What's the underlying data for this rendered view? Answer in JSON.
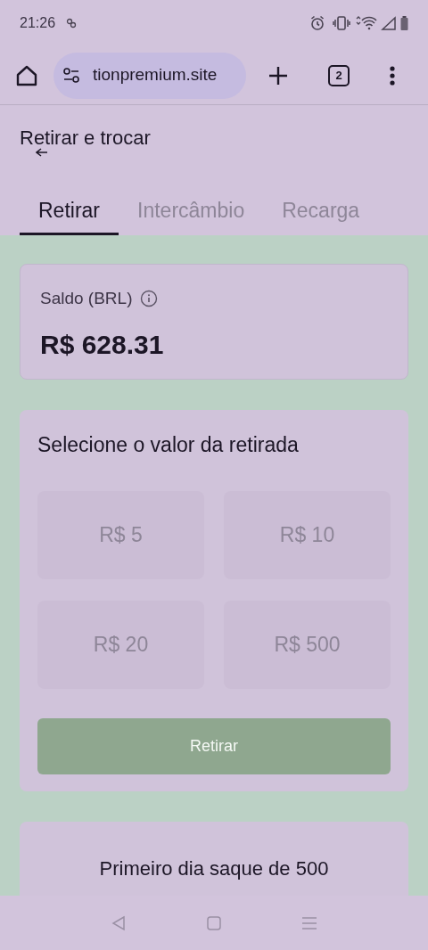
{
  "status_bar": {
    "time": "21:26"
  },
  "browser": {
    "url": "tionpremium.site",
    "tab_count": "2"
  },
  "header": {
    "title": "Retirar e trocar"
  },
  "tabs": [
    {
      "label": "Retirar",
      "selected": true
    },
    {
      "label": "Intercâmbio",
      "selected": false
    },
    {
      "label": "Recarga",
      "selected": false
    }
  ],
  "balance": {
    "label": "Saldo (BRL)",
    "amount": "R$ 628.31"
  },
  "withdraw": {
    "title": "Selecione o valor da retirada",
    "options": [
      {
        "label": "R$ 5",
        "selected": false
      },
      {
        "label": "R$ 10",
        "selected": false
      },
      {
        "label": "R$ 20",
        "selected": false
      },
      {
        "label": "R$ 500",
        "selected": false
      }
    ],
    "button": {
      "label": "Retirar",
      "disabled": true
    }
  },
  "promo": {
    "title": "Primeiro dia saque de 500"
  }
}
